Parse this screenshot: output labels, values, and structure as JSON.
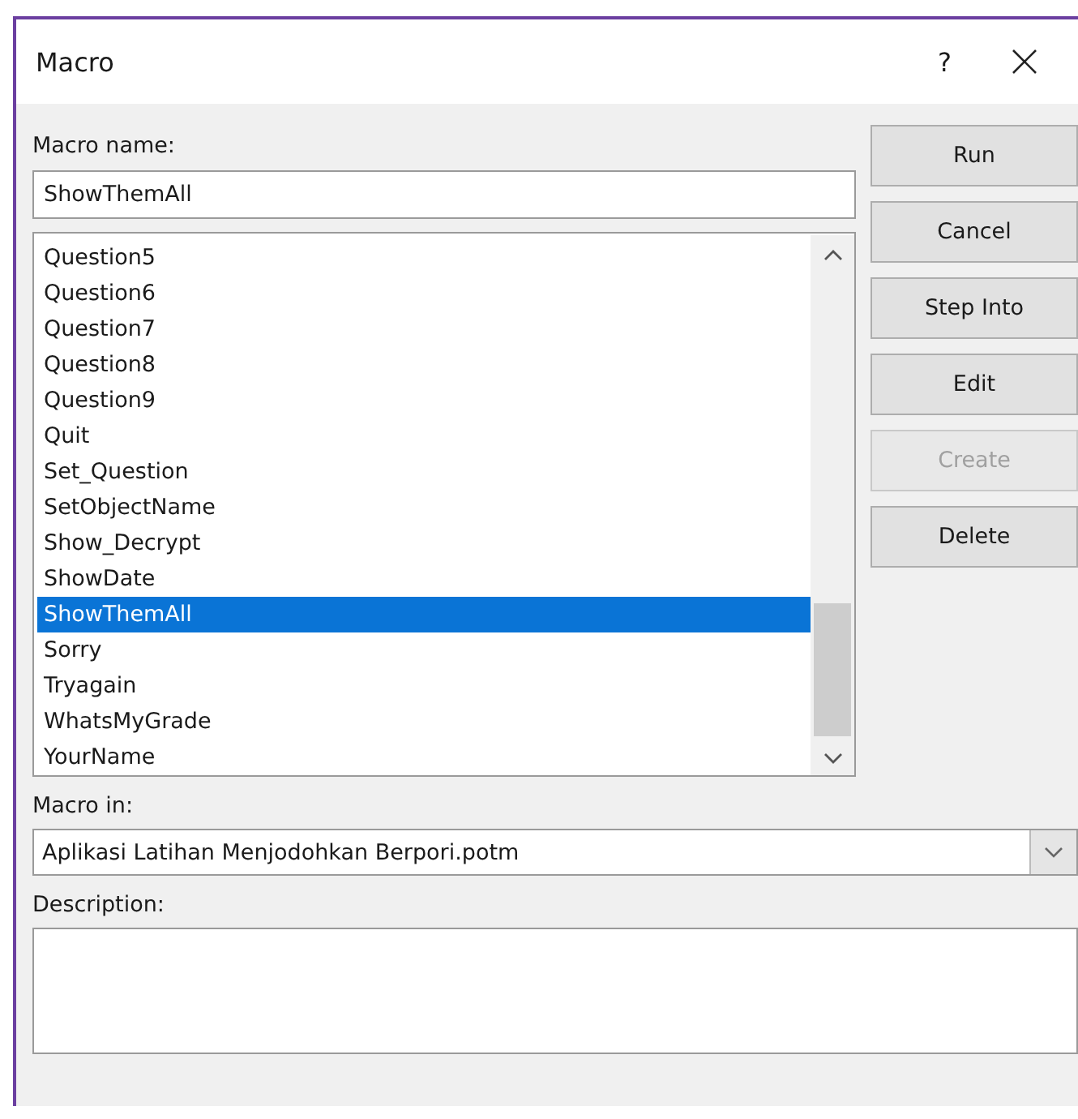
{
  "window": {
    "title": "Macro",
    "help": "?"
  },
  "macro_name": {
    "label": "Macro name:",
    "value": "ShowThemAll"
  },
  "macro_list": [
    {
      "name": "Question5",
      "selected": false
    },
    {
      "name": "Question6",
      "selected": false
    },
    {
      "name": "Question7",
      "selected": false
    },
    {
      "name": "Question8",
      "selected": false
    },
    {
      "name": "Question9",
      "selected": false
    },
    {
      "name": "Quit",
      "selected": false
    },
    {
      "name": "Set_Question",
      "selected": false
    },
    {
      "name": "SetObjectName",
      "selected": false
    },
    {
      "name": "Show_Decrypt",
      "selected": false
    },
    {
      "name": "ShowDate",
      "selected": false
    },
    {
      "name": "ShowThemAll",
      "selected": true
    },
    {
      "name": "Sorry",
      "selected": false
    },
    {
      "name": "Tryagain",
      "selected": false
    },
    {
      "name": "WhatsMyGrade",
      "selected": false
    },
    {
      "name": "YourName",
      "selected": false
    }
  ],
  "buttons": [
    {
      "label": "Run",
      "disabled": false
    },
    {
      "label": "Cancel",
      "disabled": false
    },
    {
      "label": "Step Into",
      "disabled": false
    },
    {
      "label": "Edit",
      "disabled": false
    },
    {
      "label": "Create",
      "disabled": true
    },
    {
      "label": "Delete",
      "disabled": false
    }
  ],
  "macro_in": {
    "label": "Macro in:",
    "value": "Aplikasi Latihan Menjodohkan Berpori.potm"
  },
  "description": {
    "label": "Description:"
  }
}
